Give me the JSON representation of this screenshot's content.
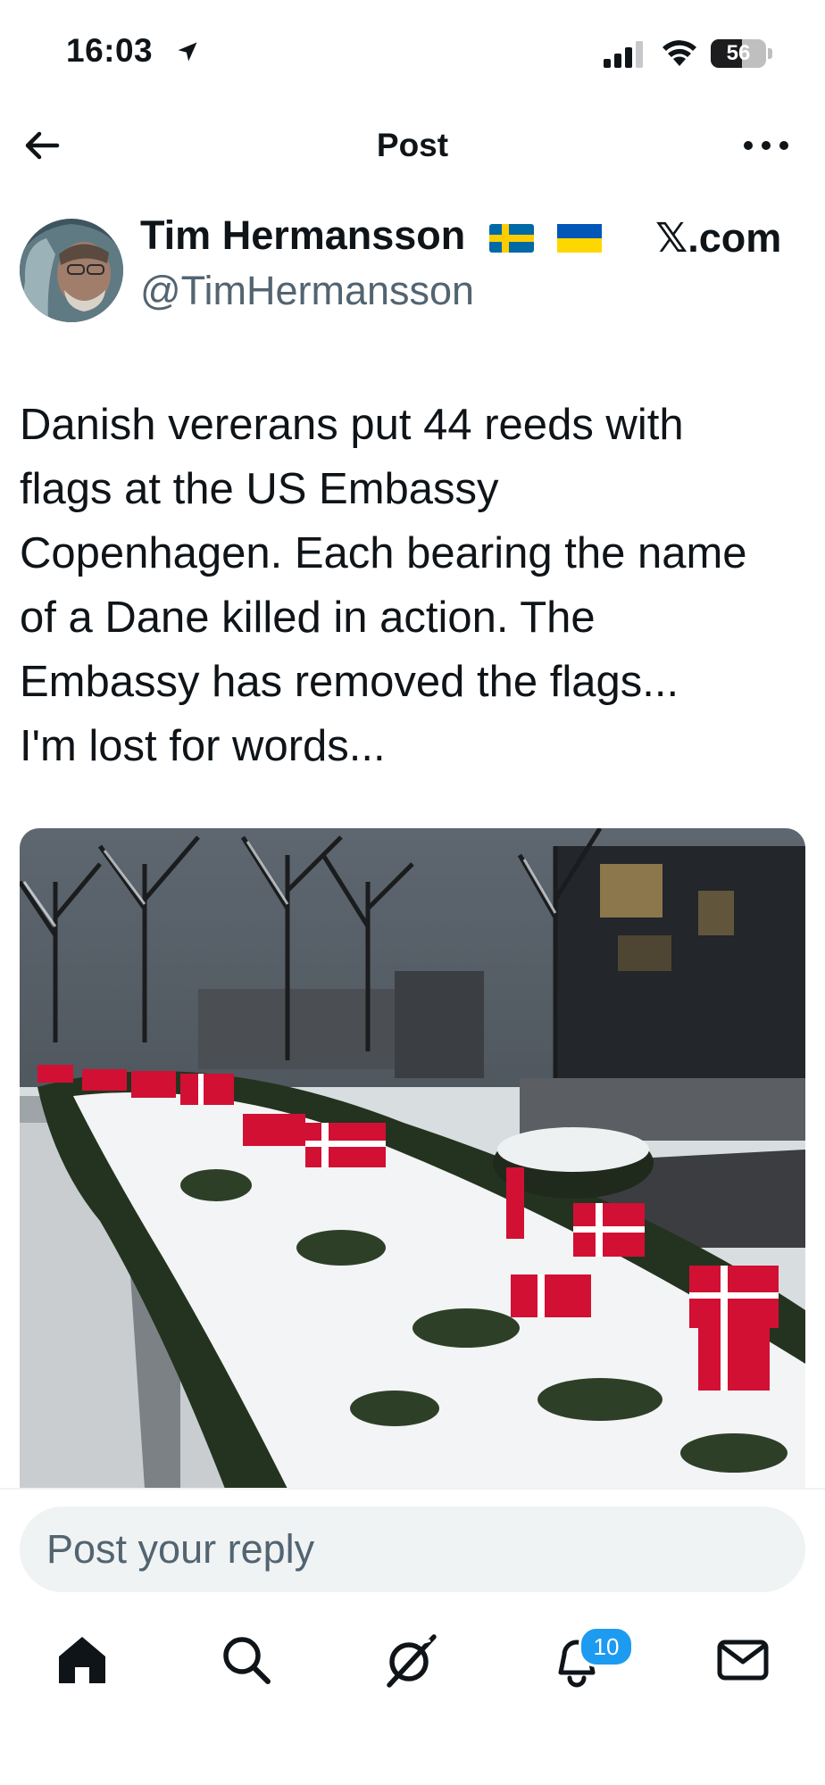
{
  "status_bar": {
    "time": "16:03",
    "battery_level": "56",
    "battery_fraction": 0.56,
    "icons": [
      "location-arrow-icon",
      "cellular-signal-icon",
      "wifi-icon",
      "battery-icon"
    ]
  },
  "header": {
    "title": "Post",
    "back_icon": "arrow-left-icon",
    "more_icon": "more-horizontal-icon"
  },
  "author": {
    "name": "Tim Hermansson",
    "flags": [
      "sweden-flag",
      "ukraine-flag"
    ],
    "handle": "@TimHermansson",
    "site": "𝕏.com"
  },
  "post": {
    "text": "Danish vererans put 44 reeds with\nflags at the US Embassy\nCopenhagen. Each bearing the name\nof a Dane killed in action. The\nEmbassy has removed the flags...\nI'm lost for words..."
  },
  "reply": {
    "placeholder": "Post your reply"
  },
  "tab_bar": {
    "items": [
      "home-icon",
      "search-icon",
      "grok-icon",
      "notifications-icon",
      "messages-icon"
    ],
    "notifications_count": "10"
  },
  "colors": {
    "text": "#0f1419",
    "secondary_text": "#536471",
    "accent": "#1d9bf0",
    "input_bg": "#eff3f4",
    "danish_flag_red": "#d21034"
  }
}
